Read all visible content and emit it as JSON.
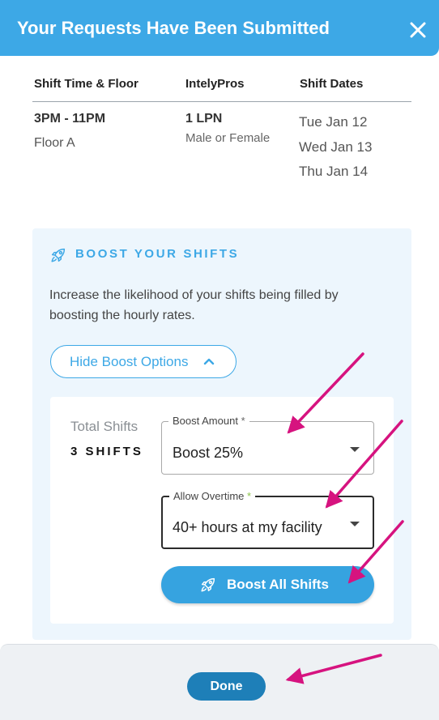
{
  "header": {
    "title": "Your Requests Have Been Submitted",
    "close_icon": "close-icon"
  },
  "table": {
    "columns": [
      "Shift Time & Floor",
      "IntelyPros",
      "Shift Dates"
    ],
    "row": {
      "shift_time": "3PM - 11PM",
      "floor": "Floor A",
      "pros": "1 LPN",
      "gender": "Male or Female",
      "dates": [
        "Tue Jan 12",
        "Wed Jan 13",
        "Thu Jan 14"
      ]
    }
  },
  "boost": {
    "icon": "rocket-icon",
    "title": "BOOST YOUR SHIFTS",
    "description": "Increase the likelihood of your shifts being filled by boosting the hourly rates.",
    "toggle_label": "Hide Boost Options",
    "toggle_icon": "chevron-up-icon",
    "total_label": "Total Shifts",
    "total_value": "3 SHIFTS",
    "amount_field": {
      "label": "Boost Amount",
      "required": "*",
      "value": "Boost 25%"
    },
    "overtime_field": {
      "label": "Allow Overtime",
      "required": "*",
      "value": "40+ hours at my facility"
    },
    "boost_all_label": "Boost All Shifts"
  },
  "footer": {
    "done_label": "Done"
  },
  "colors": {
    "accent": "#3da8e6",
    "done_button": "#1e7fb8",
    "annotation_arrow": "#d6137f",
    "required_star": "#8bc34a"
  }
}
